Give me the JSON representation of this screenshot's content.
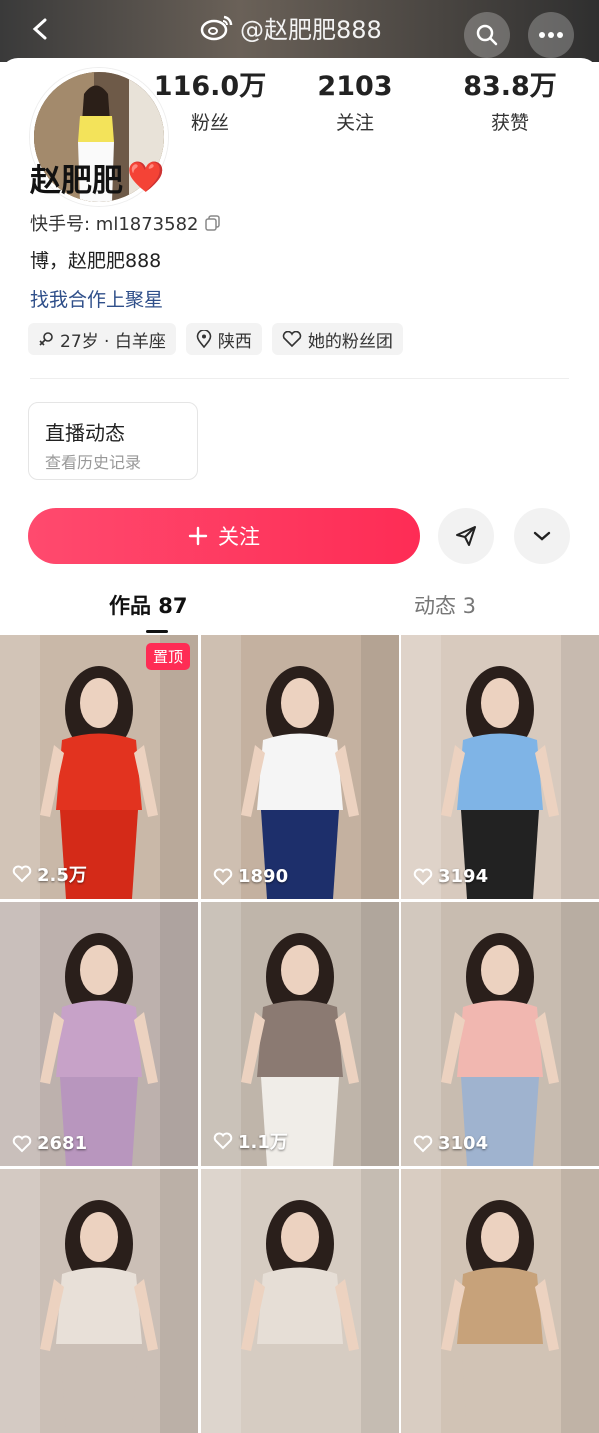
{
  "watermark": {
    "handle": "@赵肥肥888",
    "icon": "weibo-icon"
  },
  "header": {
    "back_icon": "chevron-left-icon",
    "search_icon": "search-icon",
    "more_icon": "more-dots-icon"
  },
  "profile": {
    "name": "赵肥肥",
    "name_emoji": "❤️",
    "kuaishou_id": "快手号: ml1873582",
    "bio": "博，赵肥肥888",
    "collab_link": "找我合作上聚星",
    "tags": [
      {
        "icon": "gender-female-icon",
        "label": "27岁 · 白羊座"
      },
      {
        "icon": "location-pin-icon",
        "label": "陕西"
      },
      {
        "icon": "heart-outline-icon",
        "label": "她的粉丝团"
      }
    ]
  },
  "stats": [
    {
      "value": "116.0万",
      "label": "粉丝"
    },
    {
      "value": "2103",
      "label": "关注"
    },
    {
      "value": "83.8万",
      "label": "获赞"
    }
  ],
  "live_card": {
    "title": "直播动态",
    "subtitle": "查看历史记录"
  },
  "actions": {
    "follow_label": "关注",
    "follow_icon": "plus-icon",
    "share_icon": "send-icon",
    "expand_icon": "chevron-down-icon"
  },
  "tabs": [
    {
      "label": "作品 87",
      "active": true
    },
    {
      "label": "动态 3",
      "active": false
    }
  ],
  "videos": [
    {
      "likes": "2.5万",
      "pinned_label": "置顶",
      "bg": "#c9b8a8",
      "top": "#e2331f",
      "bottom": "#d42a18"
    },
    {
      "likes": "1890",
      "bg": "#c4b1a0",
      "top": "#f5f5f5",
      "bottom": "#1d2f6b"
    },
    {
      "likes": "3194",
      "bg": "#d8cabe",
      "top": "#7fb4e6",
      "bottom": "#222222"
    },
    {
      "likes": "2681",
      "bg": "#bdb1ad",
      "top": "#c7a2c8",
      "bottom": "#b896be"
    },
    {
      "likes": "1.1万",
      "bg": "#bfb5aa",
      "top": "#8b7a72",
      "bottom": "#f0ede8"
    },
    {
      "likes": "3104",
      "bg": "#c8bcb0",
      "top": "#f1b7b0",
      "bottom": "#9fb3cf"
    },
    {
      "likes": "",
      "bg": "#cbbfb6",
      "top": "#e8e0d8",
      "bottom": "#cbbfb6"
    },
    {
      "likes": "",
      "bg": "#d6ccc2",
      "top": "#e6ded6",
      "bottom": "#d6ccc2"
    },
    {
      "likes": "",
      "bg": "#d1c3b5",
      "top": "#c7a27a",
      "bottom": "#d1c3b5"
    }
  ]
}
